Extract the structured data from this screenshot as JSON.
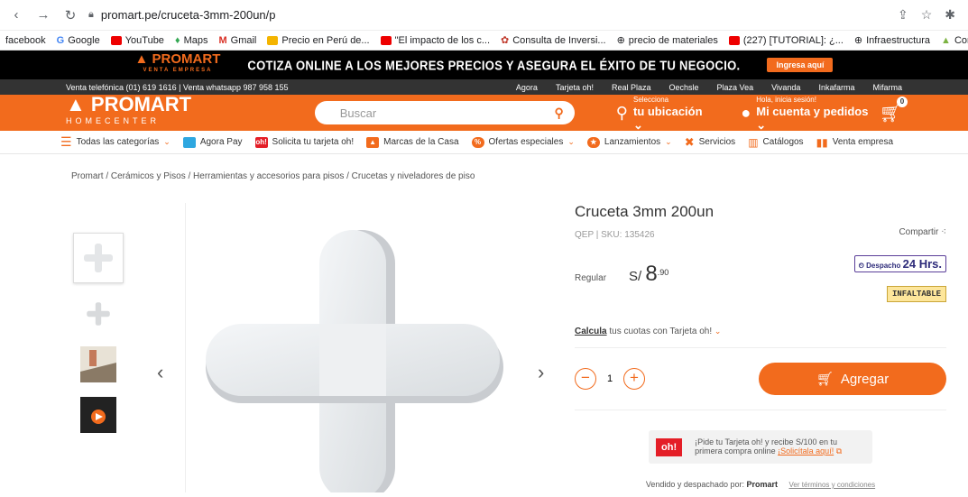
{
  "browser": {
    "url": "promart.pe/cruceta-3mm-200un/p",
    "bookmarks": [
      "facebook",
      "Google",
      "YouTube",
      "Maps",
      "Gmail",
      "Precio en Perú de...",
      "\"El impacto de los c...",
      "Consulta de Inversi...",
      "precio de materiales",
      "(227) [TUTORIAL]: ¿...",
      "Infraestructura",
      "Controlar los costos..."
    ]
  },
  "promo": {
    "logo": "PROMART",
    "logo_sub": "VENTA EMPRESA",
    "text": "COTIZA ONLINE A LOS MEJORES PRECIOS Y ASEGURA EL ÉXITO DE TU NEGOCIO.",
    "button": "Ingresa aquí"
  },
  "topbar": {
    "contact": "Venta telefónica (01) 619 1616  |  Venta whatsapp 987 958 155",
    "links": [
      "Agora",
      "Tarjeta oh!",
      "Real Plaza",
      "Oechsle",
      "Plaza Vea",
      "Vivanda",
      "Inkafarma",
      "Mifarma"
    ]
  },
  "header": {
    "logo": "PROMART",
    "logo_sub": "HOMECENTER",
    "search_placeholder": "Buscar",
    "location_small": "Selecciona",
    "location_big": "tu ubicación",
    "account_small": "Hola, inicia sesión!",
    "account_big": "Mi cuenta y pedidos",
    "cart_count": "0"
  },
  "categories": [
    "Todas las categorías",
    "Agora Pay",
    "Solicita tu tarjeta oh!",
    "Marcas de la Casa",
    "Ofertas especiales",
    "Lanzamientos",
    "Servicios",
    "Catálogos",
    "Venta empresa"
  ],
  "breadcrumb": "Promart  /  Cerámicos y Pisos  /  Herramientas y accesorios para pisos  /  Crucetas y niveladores de piso",
  "product": {
    "title": "Cruceta 3mm 200un",
    "sku": "QEP  |  SKU: 135426",
    "share": "Compartir",
    "price_label": "Regular",
    "currency": "S/",
    "price_int": "8",
    "price_dec": ".90",
    "despacho": "Despacho",
    "despacho_hours": "24 Hrs.",
    "badge": "INFALTABLE",
    "calcula_link": "Calcula",
    "calcula_text": " tus cuotas con Tarjeta oh!",
    "quantity": "1",
    "add_button": "Agregar",
    "oh_logo": "oh!",
    "oh_text": "¡Pide tu Tarjeta oh! y recibe S/100 en tu primera compra online ",
    "oh_link": "¡Solicítala aquí!",
    "sold_by_label": "Vendido y despachado por: ",
    "sold_by": "Promart",
    "terms": "Ver términos y condiciones"
  }
}
